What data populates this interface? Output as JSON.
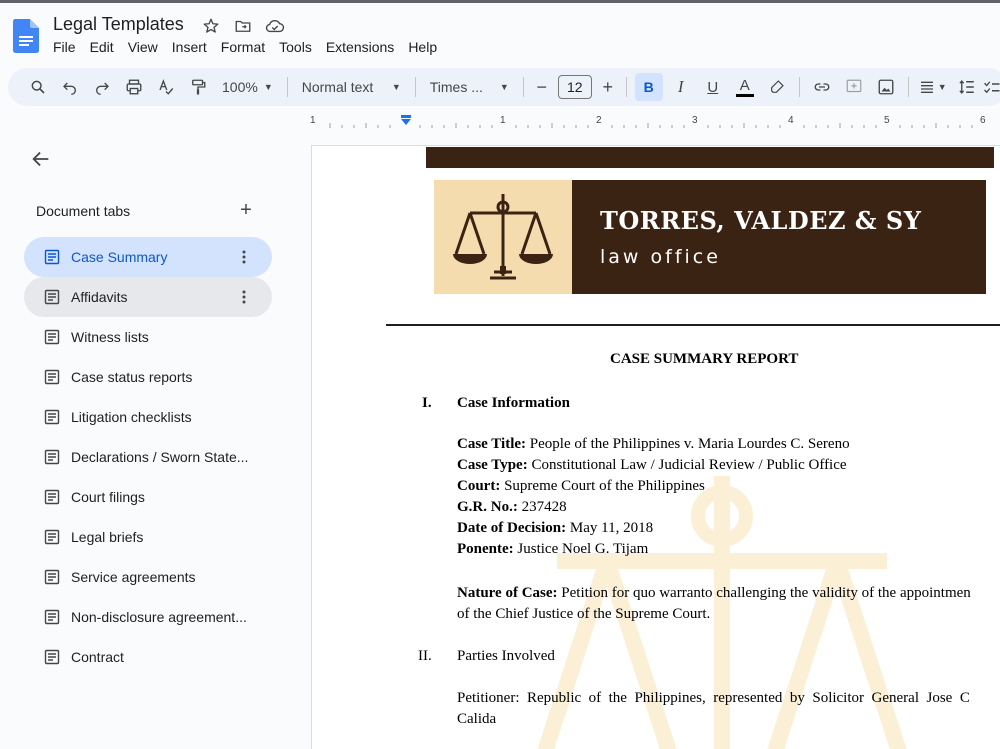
{
  "app": {
    "doc_title": "Legal Templates",
    "menu": [
      "File",
      "Edit",
      "View",
      "Insert",
      "Format",
      "Tools",
      "Extensions",
      "Help"
    ]
  },
  "toolbar": {
    "zoom": "100%",
    "paragraph_style": "Normal text",
    "font": "Times ...",
    "font_size": "12",
    "bold_label": "B",
    "italic_label": "I",
    "underline_label": "U",
    "text_color_label": "A"
  },
  "ruler": {
    "labels": [
      "1",
      "1",
      "2",
      "3",
      "4",
      "5",
      "6"
    ]
  },
  "sidebar": {
    "tabs_title": "Document tabs",
    "tabs": [
      {
        "label": "Case Summary",
        "state": "active"
      },
      {
        "label": "Affidavits",
        "state": "hover"
      },
      {
        "label": "Witness lists",
        "state": ""
      },
      {
        "label": "Case status reports",
        "state": ""
      },
      {
        "label": "Litigation checklists",
        "state": ""
      },
      {
        "label": "Declarations / Sworn State...",
        "state": ""
      },
      {
        "label": "Court filings",
        "state": ""
      },
      {
        "label": "Legal briefs",
        "state": ""
      },
      {
        "label": "Service agreements",
        "state": ""
      },
      {
        "label": "Non-disclosure agreement...",
        "state": ""
      },
      {
        "label": "Contract",
        "state": ""
      }
    ]
  },
  "document": {
    "firm_name": "TORRES, VALDEZ & SY",
    "firm_sub": "law office",
    "report_title": "CASE SUMMARY REPORT",
    "sec1_num": "I.",
    "sec1_title": "Case Information",
    "case_title_label": "Case Title:",
    "case_title_value": " People of the Philippines v. Maria Lourdes C. Sereno",
    "case_type_label": "Case Type:",
    "case_type_value": " Constitutional Law / Judicial Review / Public Office",
    "court_label": "Court:",
    "court_value": " Supreme Court of the Philippines",
    "gr_label": "G.R. No.:",
    "gr_value": " 237428",
    "date_label": "Date of Decision:",
    "date_value": " May 11, 2018",
    "ponente_label": "Ponente:",
    "ponente_value": " Justice Noel G. Tijam",
    "nature_label": "Nature of Case:",
    "nature_value": " Petition for quo warranto challenging the validity of the appointmen",
    "nature_line2": "of the Chief Justice of the Supreme Court.",
    "sec2_num": "II.",
    "sec2_title": "Parties Involved",
    "petitioner_line1": "Petitioner:  Republic  of  the  Philippines,  represented  by  Solicitor  General  Jose  C",
    "petitioner_line2": "Calida"
  },
  "colors": {
    "accent_blue": "#0b57d0",
    "active_tab_bg": "#d3e3fd",
    "banner_brown": "#3b2314",
    "banner_tan": "#f5dcae"
  }
}
